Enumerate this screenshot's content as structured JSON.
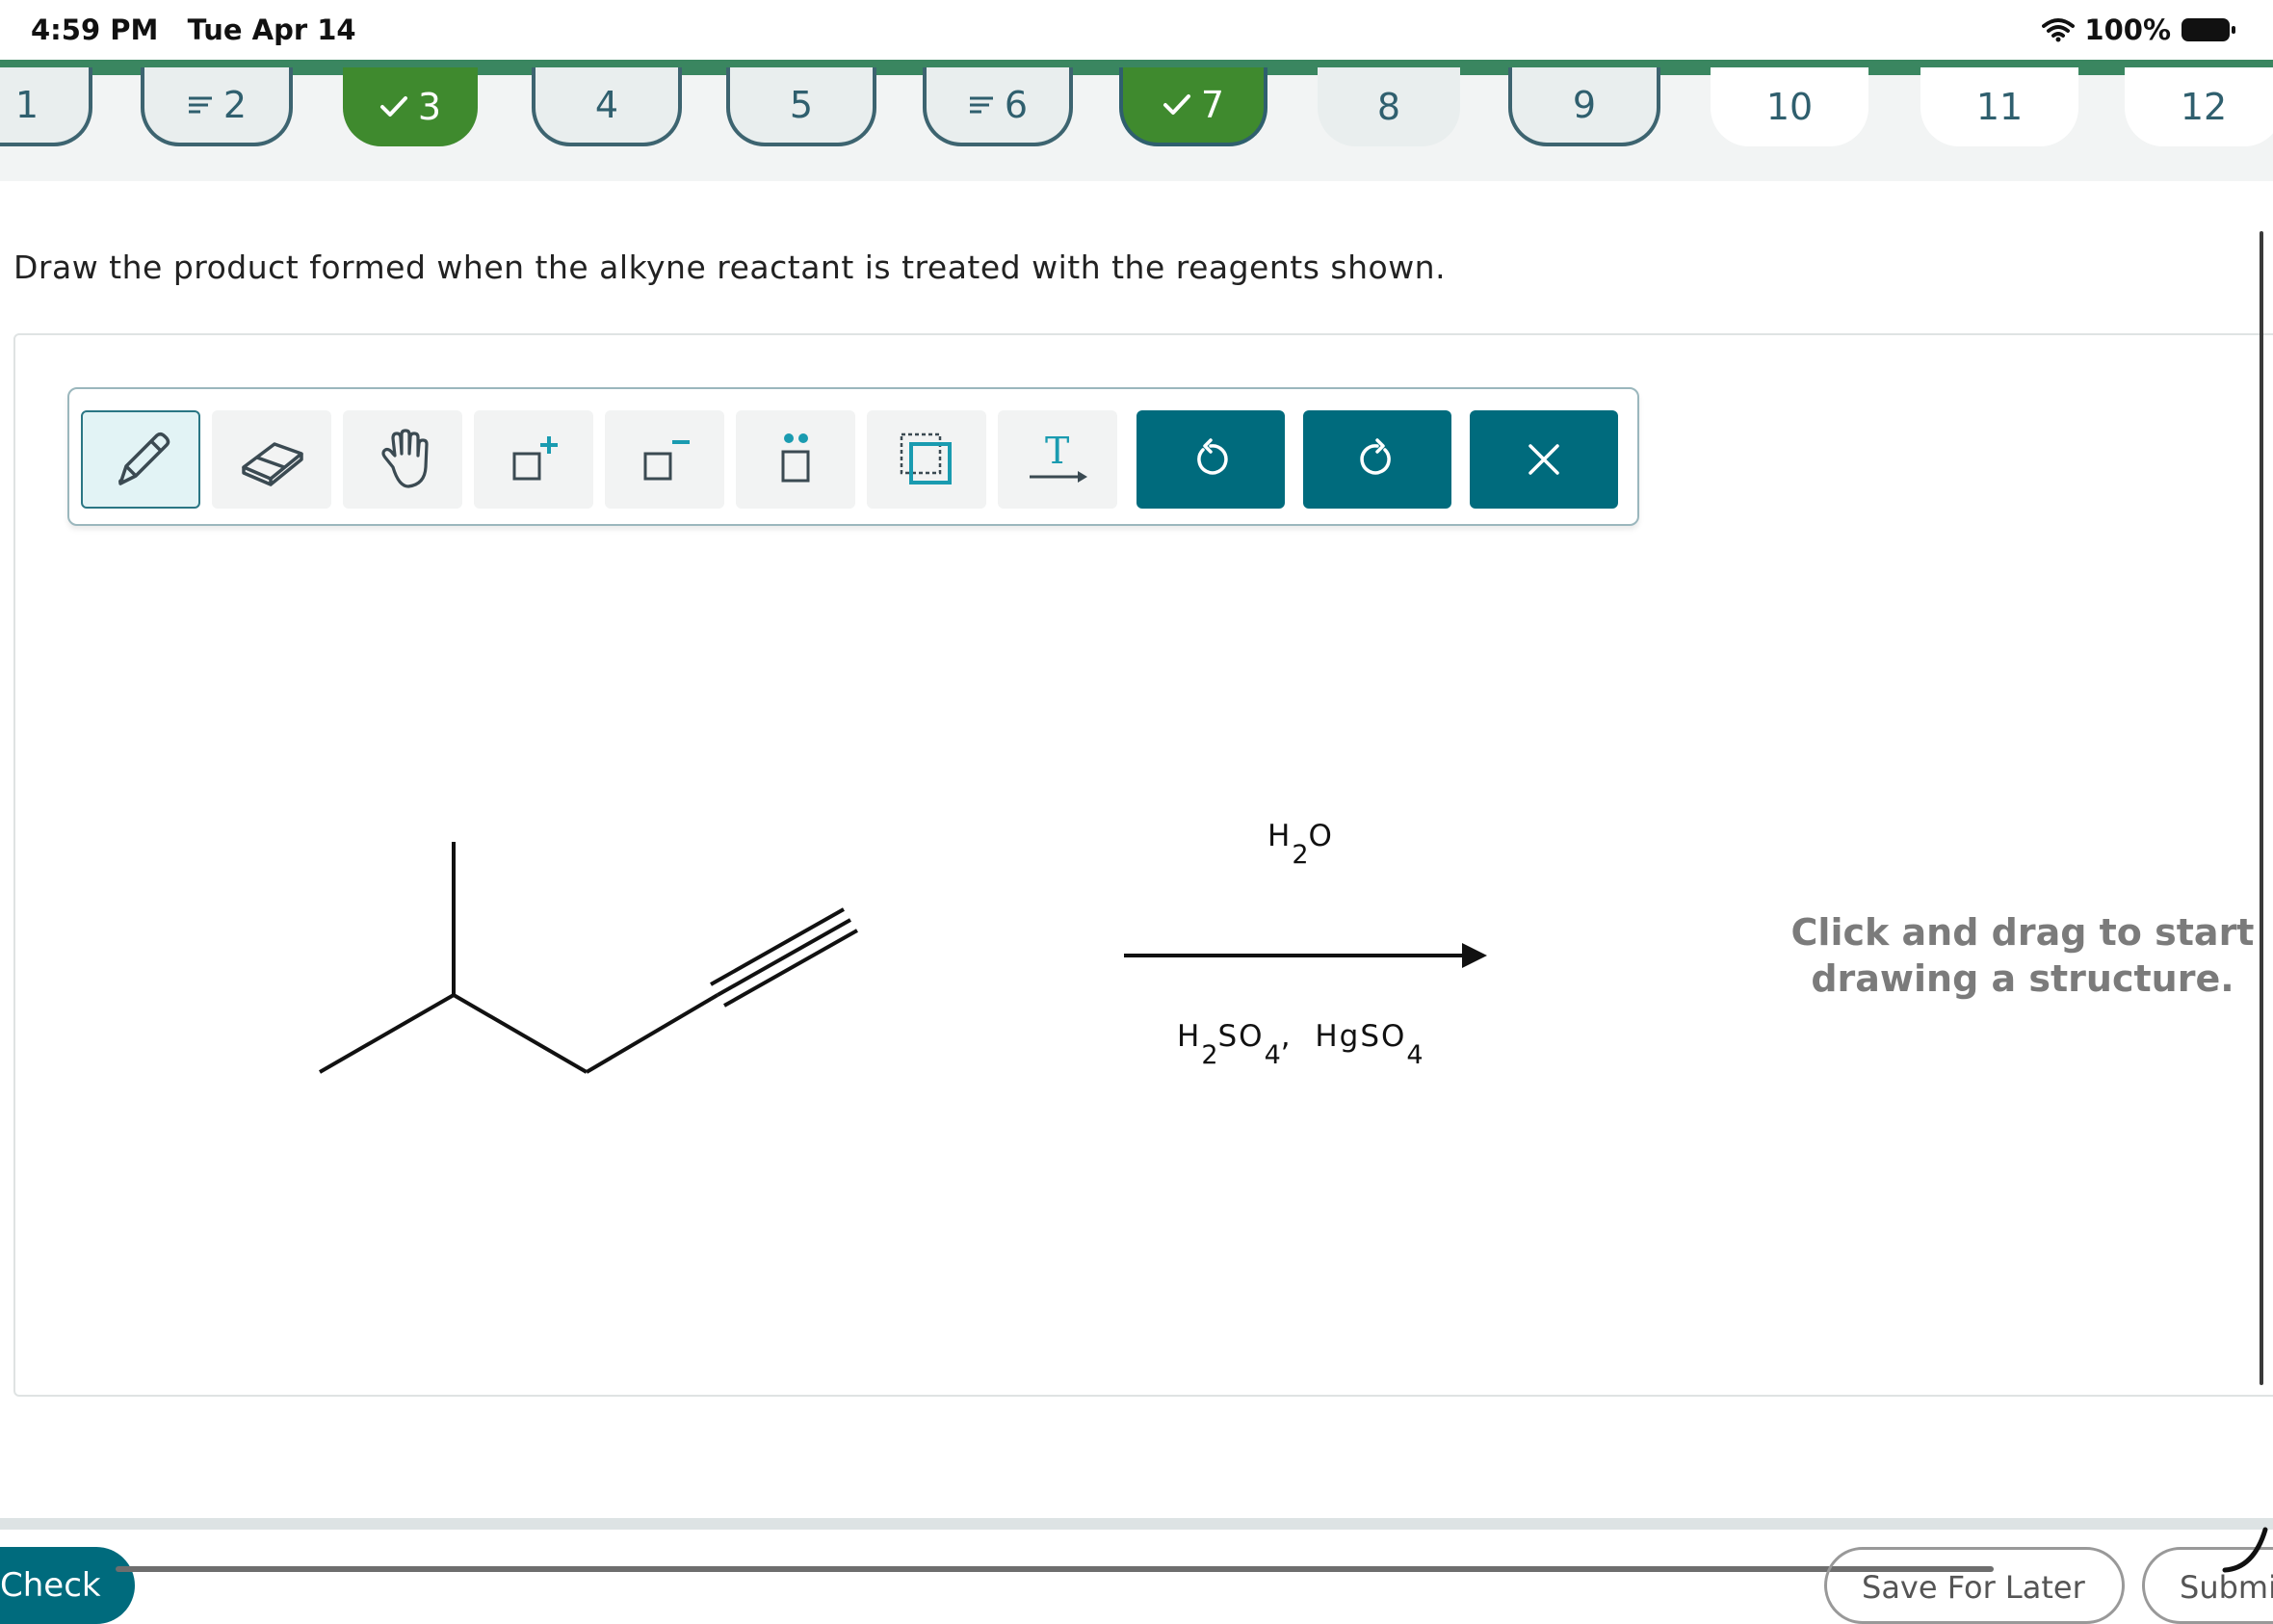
{
  "status_bar": {
    "time": "4:59 PM",
    "date": "Tue Apr 14",
    "battery": "100%"
  },
  "nav": {
    "items": [
      {
        "label": "1",
        "state": "outlined",
        "flag": false,
        "check": false
      },
      {
        "label": "2",
        "state": "outlined",
        "flag": true,
        "check": false
      },
      {
        "label": "3",
        "state": "done",
        "flag": false,
        "check": true
      },
      {
        "label": "4",
        "state": "outlined",
        "flag": false,
        "check": false
      },
      {
        "label": "5",
        "state": "outlined",
        "flag": false,
        "check": false
      },
      {
        "label": "6",
        "state": "outlined",
        "flag": true,
        "check": false
      },
      {
        "label": "7",
        "state": "done-outlined",
        "flag": false,
        "check": true
      },
      {
        "label": "8",
        "state": "plain",
        "flag": false,
        "check": false
      },
      {
        "label": "9",
        "state": "outlined",
        "flag": false,
        "check": false
      },
      {
        "label": "10",
        "state": "white",
        "flag": false,
        "check": false
      },
      {
        "label": "11",
        "state": "white",
        "flag": false,
        "check": false
      },
      {
        "label": "12",
        "state": "white",
        "flag": false,
        "check": false
      }
    ]
  },
  "question": {
    "text": "Draw the product formed when the alkyne reactant is treated with the reagents shown."
  },
  "toolbar": {
    "tools": [
      {
        "name": "pencil-tool",
        "icon": "pencil-icon"
      },
      {
        "name": "eraser-tool",
        "icon": "eraser-icon"
      },
      {
        "name": "hand-tool",
        "icon": "hand-icon"
      },
      {
        "name": "add-charge-tool",
        "icon": "positive-charge-icon"
      },
      {
        "name": "subtract-charge-tool",
        "icon": "negative-charge-icon"
      },
      {
        "name": "lone-pair-tool",
        "icon": "lone-pair-icon"
      },
      {
        "name": "select-tool",
        "icon": "marquee-select-icon"
      },
      {
        "name": "text-tool",
        "icon": "text-arrow-icon"
      },
      {
        "name": "undo-button",
        "icon": "undo-icon"
      },
      {
        "name": "redo-button",
        "icon": "redo-icon"
      },
      {
        "name": "clear-button",
        "icon": "close-icon"
      }
    ]
  },
  "reaction": {
    "reagent_top": {
      "a": "H",
      "sub_a": "2",
      "b": "O"
    },
    "reagent_bottom": {
      "a": "H",
      "sub_a": "2",
      "b": "SO",
      "sub_b": "4",
      "sep": ",",
      "c": "HgSO",
      "sub_c": "4"
    }
  },
  "hint": {
    "line1": "Click and drag to start",
    "line2": "drawing a structure."
  },
  "buttons": {
    "check": "Check",
    "save": "Save For Later",
    "submit": "Submit"
  },
  "colors": {
    "accent": "#006b7d",
    "done": "#3f8a2e",
    "nav_border": "#3a8660"
  }
}
